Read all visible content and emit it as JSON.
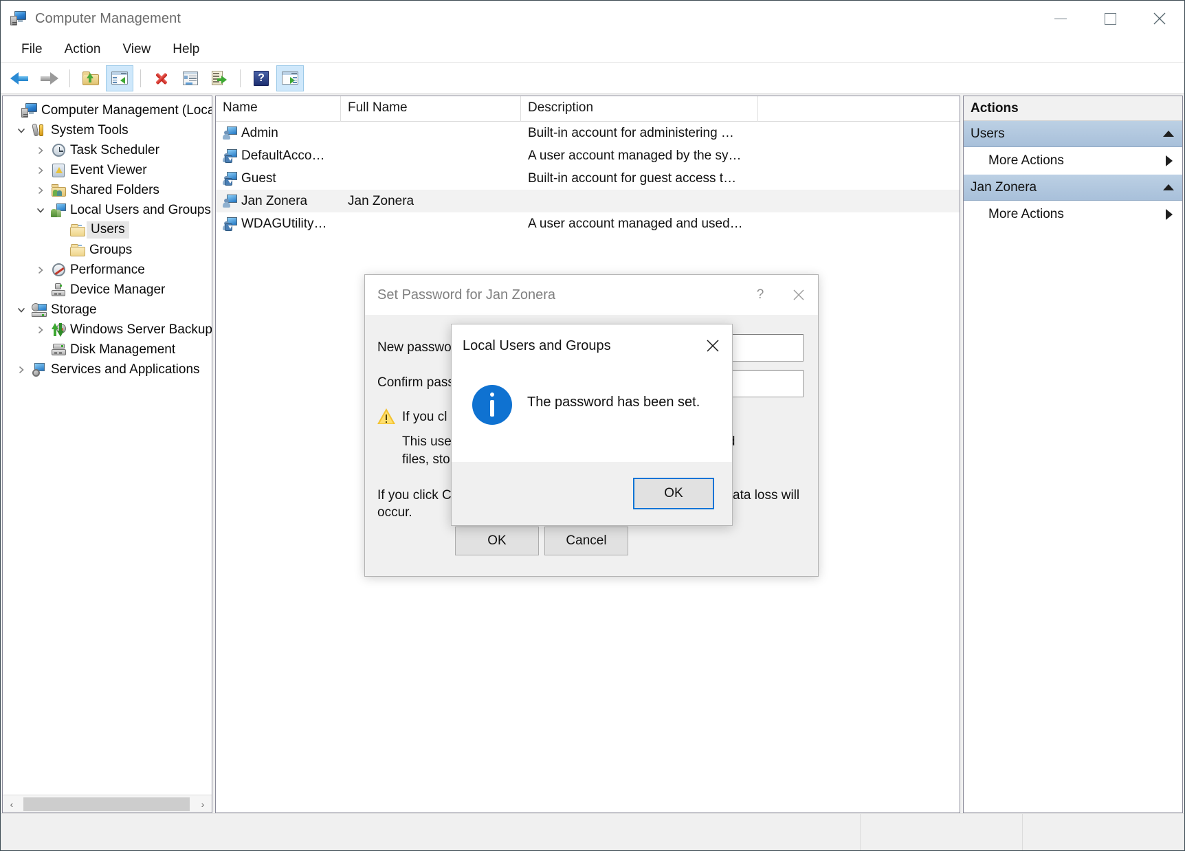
{
  "window": {
    "title": "Computer Management",
    "icon": "computer-management-icon",
    "buttons": {
      "minimize": "—",
      "maximize": "□",
      "close": "✕"
    }
  },
  "menubar": {
    "items": [
      "File",
      "Action",
      "View",
      "Help"
    ]
  },
  "toolbar": {
    "items": [
      {
        "name": "back-button",
        "icon": "back-arrow-icon"
      },
      {
        "name": "forward-button",
        "icon": "forward-arrow-icon"
      },
      {
        "name": "up-one-level-button",
        "icon": "folder-up-icon"
      },
      {
        "name": "show-hide-console-tree-button",
        "icon": "console-tree-icon",
        "active": true
      },
      {
        "name": "delete-button",
        "icon": "red-x-icon"
      },
      {
        "name": "properties-button",
        "icon": "properties-icon"
      },
      {
        "name": "export-list-button",
        "icon": "export-list-icon"
      },
      {
        "name": "help-button",
        "icon": "question-mark-icon"
      },
      {
        "name": "show-action-pane-button",
        "icon": "action-pane-icon",
        "active": true
      }
    ]
  },
  "tree": {
    "items": [
      {
        "label": "Computer Management (Local)",
        "indent": 0,
        "twisty": "none",
        "icon": "computer-management-icon",
        "selected": false
      },
      {
        "label": "System Tools",
        "indent": 1,
        "twisty": "expanded",
        "icon": "system-tools-icon",
        "selected": false
      },
      {
        "label": "Task Scheduler",
        "indent": 2,
        "twisty": "collapsed",
        "icon": "task-scheduler-icon",
        "selected": false
      },
      {
        "label": "Event Viewer",
        "indent": 2,
        "twisty": "collapsed",
        "icon": "event-viewer-icon",
        "selected": false
      },
      {
        "label": "Shared Folders",
        "indent": 2,
        "twisty": "collapsed",
        "icon": "shared-folders-icon",
        "selected": false
      },
      {
        "label": "Local Users and Groups",
        "indent": 2,
        "twisty": "expanded",
        "icon": "local-users-groups-icon",
        "selected": false
      },
      {
        "label": "Users",
        "indent": 3,
        "twisty": "none",
        "icon": "folder-icon",
        "selected": true
      },
      {
        "label": "Groups",
        "indent": 3,
        "twisty": "none",
        "icon": "folder-icon",
        "selected": false
      },
      {
        "label": "Performance",
        "indent": 2,
        "twisty": "collapsed",
        "icon": "performance-icon",
        "selected": false
      },
      {
        "label": "Device Manager",
        "indent": 2,
        "twisty": "none",
        "icon": "device-manager-icon",
        "selected": false
      },
      {
        "label": "Storage",
        "indent": 1,
        "twisty": "expanded",
        "icon": "storage-icon",
        "selected": false
      },
      {
        "label": "Windows Server Backup",
        "indent": 2,
        "twisty": "collapsed",
        "icon": "server-backup-icon",
        "selected": false
      },
      {
        "label": "Disk Management",
        "indent": 2,
        "twisty": "none",
        "icon": "disk-management-icon",
        "selected": false
      },
      {
        "label": "Services and Applications",
        "indent": 1,
        "twisty": "collapsed",
        "icon": "services-applications-icon",
        "selected": false
      }
    ],
    "hscroll": {
      "left_arrow": "‹",
      "right_arrow": "›"
    }
  },
  "list": {
    "columns": [
      "Name",
      "Full Name",
      "Description"
    ],
    "rows": [
      {
        "name": "Admin",
        "full_name": "",
        "description": "Built-in account for administering …",
        "icon": "user-icon",
        "disabled": false,
        "selected": false
      },
      {
        "name": "DefaultAcco…",
        "full_name": "",
        "description": "A user account managed by the sy…",
        "icon": "user-icon",
        "disabled": true,
        "selected": false
      },
      {
        "name": "Guest",
        "full_name": "",
        "description": "Built-in account for guest access t…",
        "icon": "user-icon",
        "disabled": true,
        "selected": false
      },
      {
        "name": "Jan Zonera",
        "full_name": "Jan Zonera",
        "description": "",
        "icon": "user-icon",
        "disabled": false,
        "selected": true
      },
      {
        "name": "WDAGUtility…",
        "full_name": "",
        "description": "A user account managed and used…",
        "icon": "user-icon",
        "disabled": true,
        "selected": false
      }
    ]
  },
  "actions": {
    "title": "Actions",
    "groups": [
      {
        "header": "Users",
        "collapse_icon": "chevron-up-icon",
        "items": [
          {
            "label": "More Actions",
            "submenu_icon": "chevron-right-icon"
          }
        ]
      },
      {
        "header": "Jan Zonera",
        "collapse_icon": "chevron-up-icon",
        "items": [
          {
            "label": "More Actions",
            "submenu_icon": "chevron-right-icon"
          }
        ]
      }
    ]
  },
  "set_password_dialog": {
    "title": "Set Password for Jan Zonera",
    "help_button": "?",
    "close_button": "✕",
    "new_password_label": "New passwo",
    "confirm_password_label": "Confirm pass",
    "new_password_value": "",
    "confirm_password_value": "",
    "warning_icon": "warning-triangle-icon",
    "warning_line1": "If you cl",
    "warning_line2": "This use",
    "warning_line2_right": "encrypted",
    "warning_line3": "files, sto",
    "caution_line1": "If you click Ca",
    "caution_line1_right": "ata loss will",
    "caution_line2": "occur.",
    "ok_label": "OK",
    "cancel_label": "Cancel"
  },
  "message_box": {
    "title": "Local Users and Groups",
    "close_button": "✕",
    "icon": "info-icon",
    "message": "The password has been set.",
    "ok_label": "OK"
  },
  "statusbar": {
    "text": ""
  },
  "colors": {
    "accent_blue": "#0f72d1",
    "focus_border": "#0a74d6",
    "action_header": "#a8c0da",
    "selection_gray": "#f2f2f2",
    "window_border": "#3c4a52"
  }
}
